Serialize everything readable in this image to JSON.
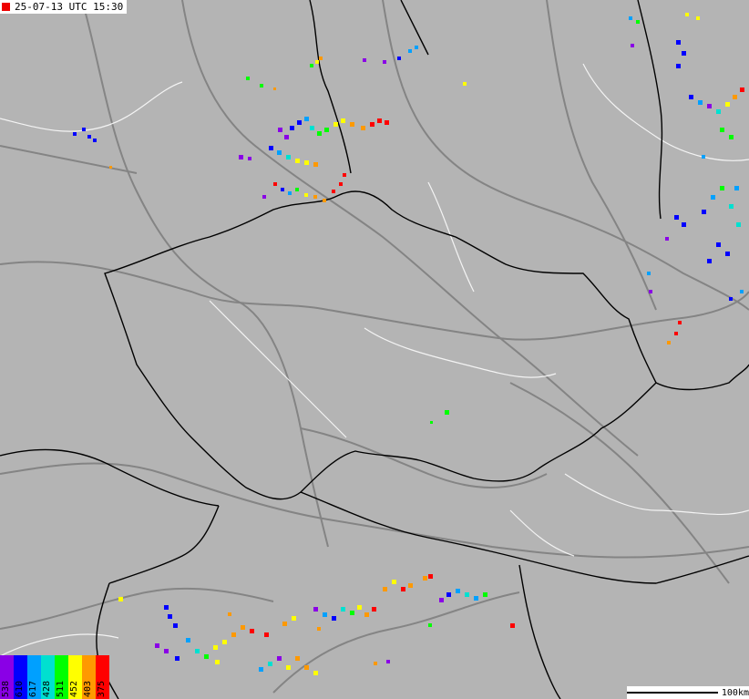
{
  "timestamp": "25-07-13 UTC 15:30",
  "legend": [
    {
      "label": "538",
      "color": "#8a00e6"
    },
    {
      "label": "610",
      "color": "#0000ff"
    },
    {
      "label": "617",
      "color": "#00a0ff"
    },
    {
      "label": "428",
      "color": "#00e0d0"
    },
    {
      "label": "511",
      "color": "#00ff00"
    },
    {
      "label": "452",
      "color": "#ffff00"
    },
    {
      "label": "403",
      "color": "#ff9900"
    },
    {
      "label": "375",
      "color": "#ff0000"
    }
  ],
  "scale_label": "100km",
  "colors": {
    "background": "#b4b4b4",
    "border": "#000000",
    "roads": "#808080",
    "regions": "#ffffff"
  }
}
